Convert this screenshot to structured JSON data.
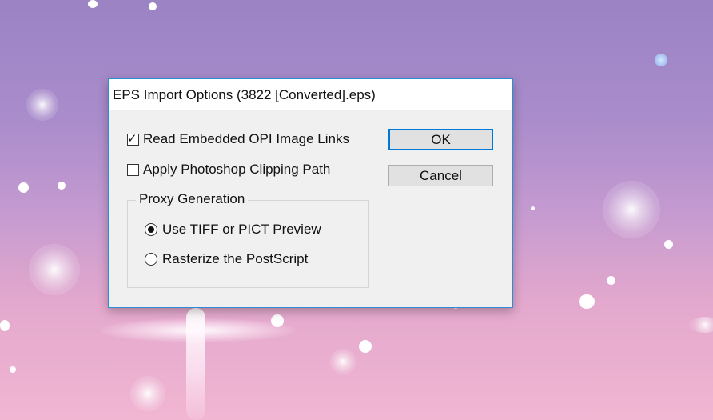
{
  "dialog": {
    "title": "EPS Import Options (3822 [Converted].eps)",
    "options": {
      "read_opi_label": "Read Embedded OPI Image Links",
      "read_opi_checked": true,
      "clipping_label": "Apply Photoshop Clipping Path",
      "clipping_checked": false
    },
    "proxy_group": {
      "label": "Proxy Generation",
      "radios": [
        {
          "label": "Use TIFF or PICT Preview",
          "selected": true
        },
        {
          "label": "Rasterize the PostScript",
          "selected": false
        }
      ]
    },
    "buttons": {
      "ok_label": "OK",
      "cancel_label": "Cancel"
    }
  },
  "colors": {
    "accent": "#0078d7",
    "dialog_background": "#f0f0f0",
    "window_border": "#2e8bd6"
  }
}
